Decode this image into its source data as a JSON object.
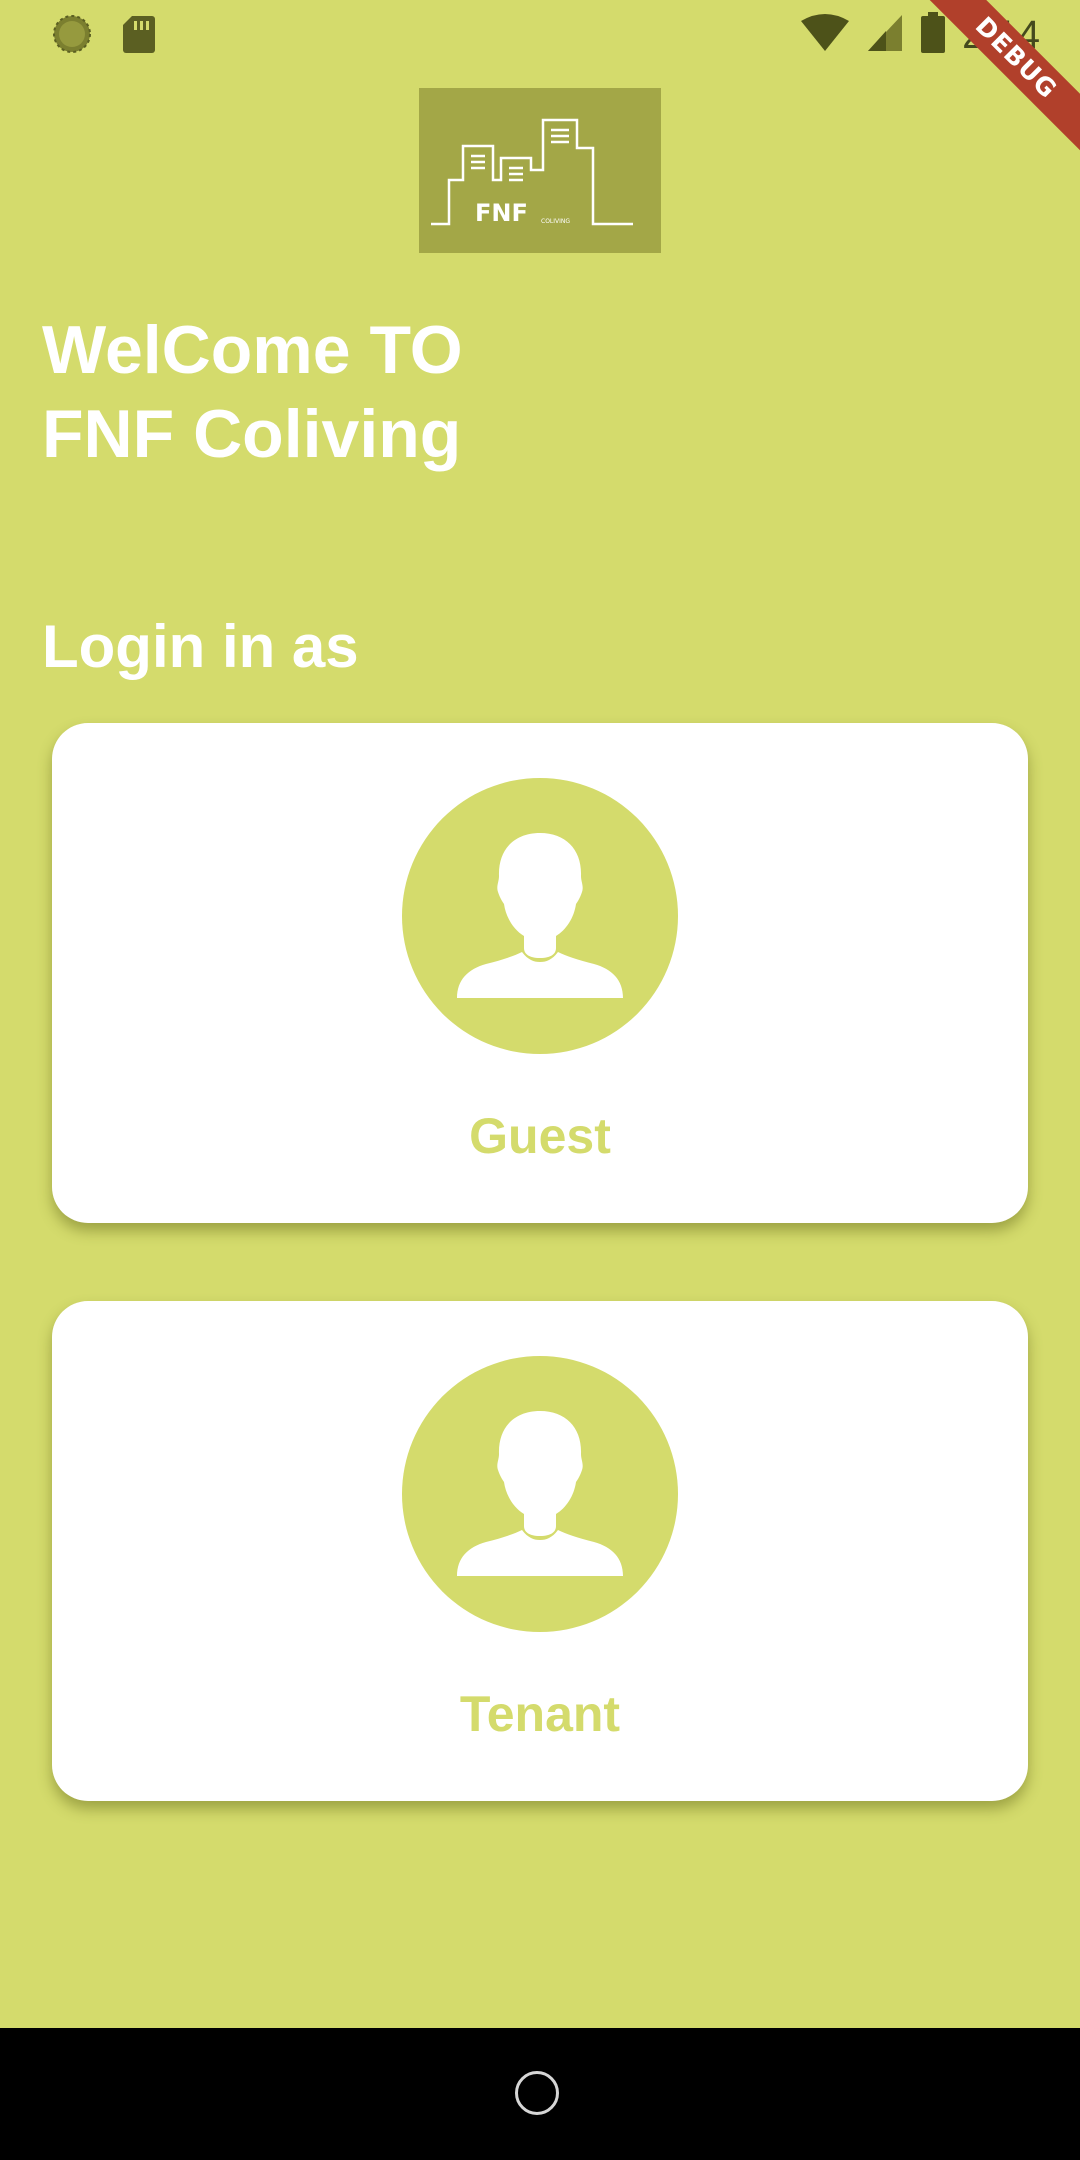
{
  "status_bar": {
    "time": "2:14",
    "left_icons": [
      "sync-icon",
      "sd-card-icon"
    ],
    "right_icons": [
      "wifi-icon",
      "cell-signal-icon",
      "battery-icon"
    ]
  },
  "debug_banner": "DEBUG",
  "logo": {
    "brand": "FNF",
    "tagline": "COLIVING"
  },
  "welcome": {
    "line1": "WelCome TO",
    "line2": "FNF Coliving"
  },
  "login_heading": "Login in as",
  "options": [
    {
      "label": "Guest",
      "icon": "person-avatar-icon"
    },
    {
      "label": "Tenant",
      "icon": "person-avatar-icon"
    }
  ],
  "colors": {
    "background": "#d4db6c",
    "logo_bg": "#a3a747",
    "card": "#ffffff",
    "accent_text": "#d4db6c",
    "debug": "#b1402b"
  }
}
